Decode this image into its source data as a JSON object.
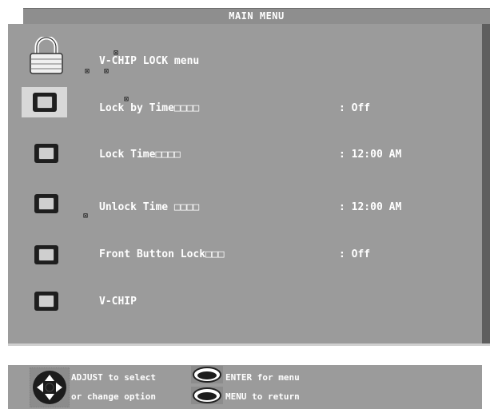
{
  "header": {
    "title": "MAIN MENU"
  },
  "menu": {
    "heading": "V-CHIP LOCK menu",
    "rows": [
      {
        "label": "Lock by Time□□□□",
        "value": ": Off"
      },
      {
        "label": "Lock Time□□□□",
        "value": ": 12:00 AM"
      },
      {
        "label": "Unlock Time □□□□",
        "value": ": 12:00 AM"
      },
      {
        "label": "Front Button Lock□□□",
        "value": ": Off"
      },
      {
        "label": "V-CHIP",
        "value": ""
      }
    ],
    "marks": [
      "⊠",
      "⊠",
      "⊠",
      "⊠",
      "⊠"
    ]
  },
  "footer": {
    "adjust_line1": "ADJUST to select",
    "adjust_line2": "or change option",
    "enter_text": "ENTER for menu",
    "menu_text": "MENU to return"
  },
  "icons": {
    "lock": "padlock-icon",
    "row": "square-button-icon",
    "dpad": "direction-pad-icon",
    "oval": "oval-button-icon"
  },
  "colors": {
    "panel": "#9b9b9b",
    "title_bar": "#8e8e8e",
    "shadow": "#5e5e5e",
    "text": "#ffffff"
  }
}
